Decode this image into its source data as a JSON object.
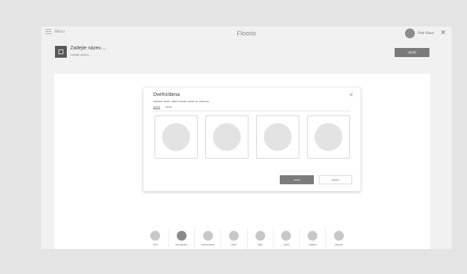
{
  "topbar": {
    "menu_label": "Menu",
    "app_title": "Floorio",
    "user_name": "Petr Klaus"
  },
  "document": {
    "title": "Zadejte název....",
    "subtitle": "Zadejte adresu...",
    "save_label": "uložit"
  },
  "dialog": {
    "title": "Dveřní/dena",
    "subtitle": "Vyberte dveře, které chcete uložit do nákresu.",
    "tabs": [
      {
        "label": "dveře"
      },
      {
        "label": "okna"
      }
    ],
    "primary_label": "uložit",
    "secondary_label": "storno"
  },
  "bottom_bar": {
    "items": [
      {
        "label": "Zeď"
      },
      {
        "label": "otvírávání"
      },
      {
        "label": "dveře/okna"
      },
      {
        "label": "zařiz"
      },
      {
        "label": "lišty"
      },
      {
        "label": "světl"
      },
      {
        "label": "nářadí"
      },
      {
        "label": "import"
      }
    ]
  }
}
